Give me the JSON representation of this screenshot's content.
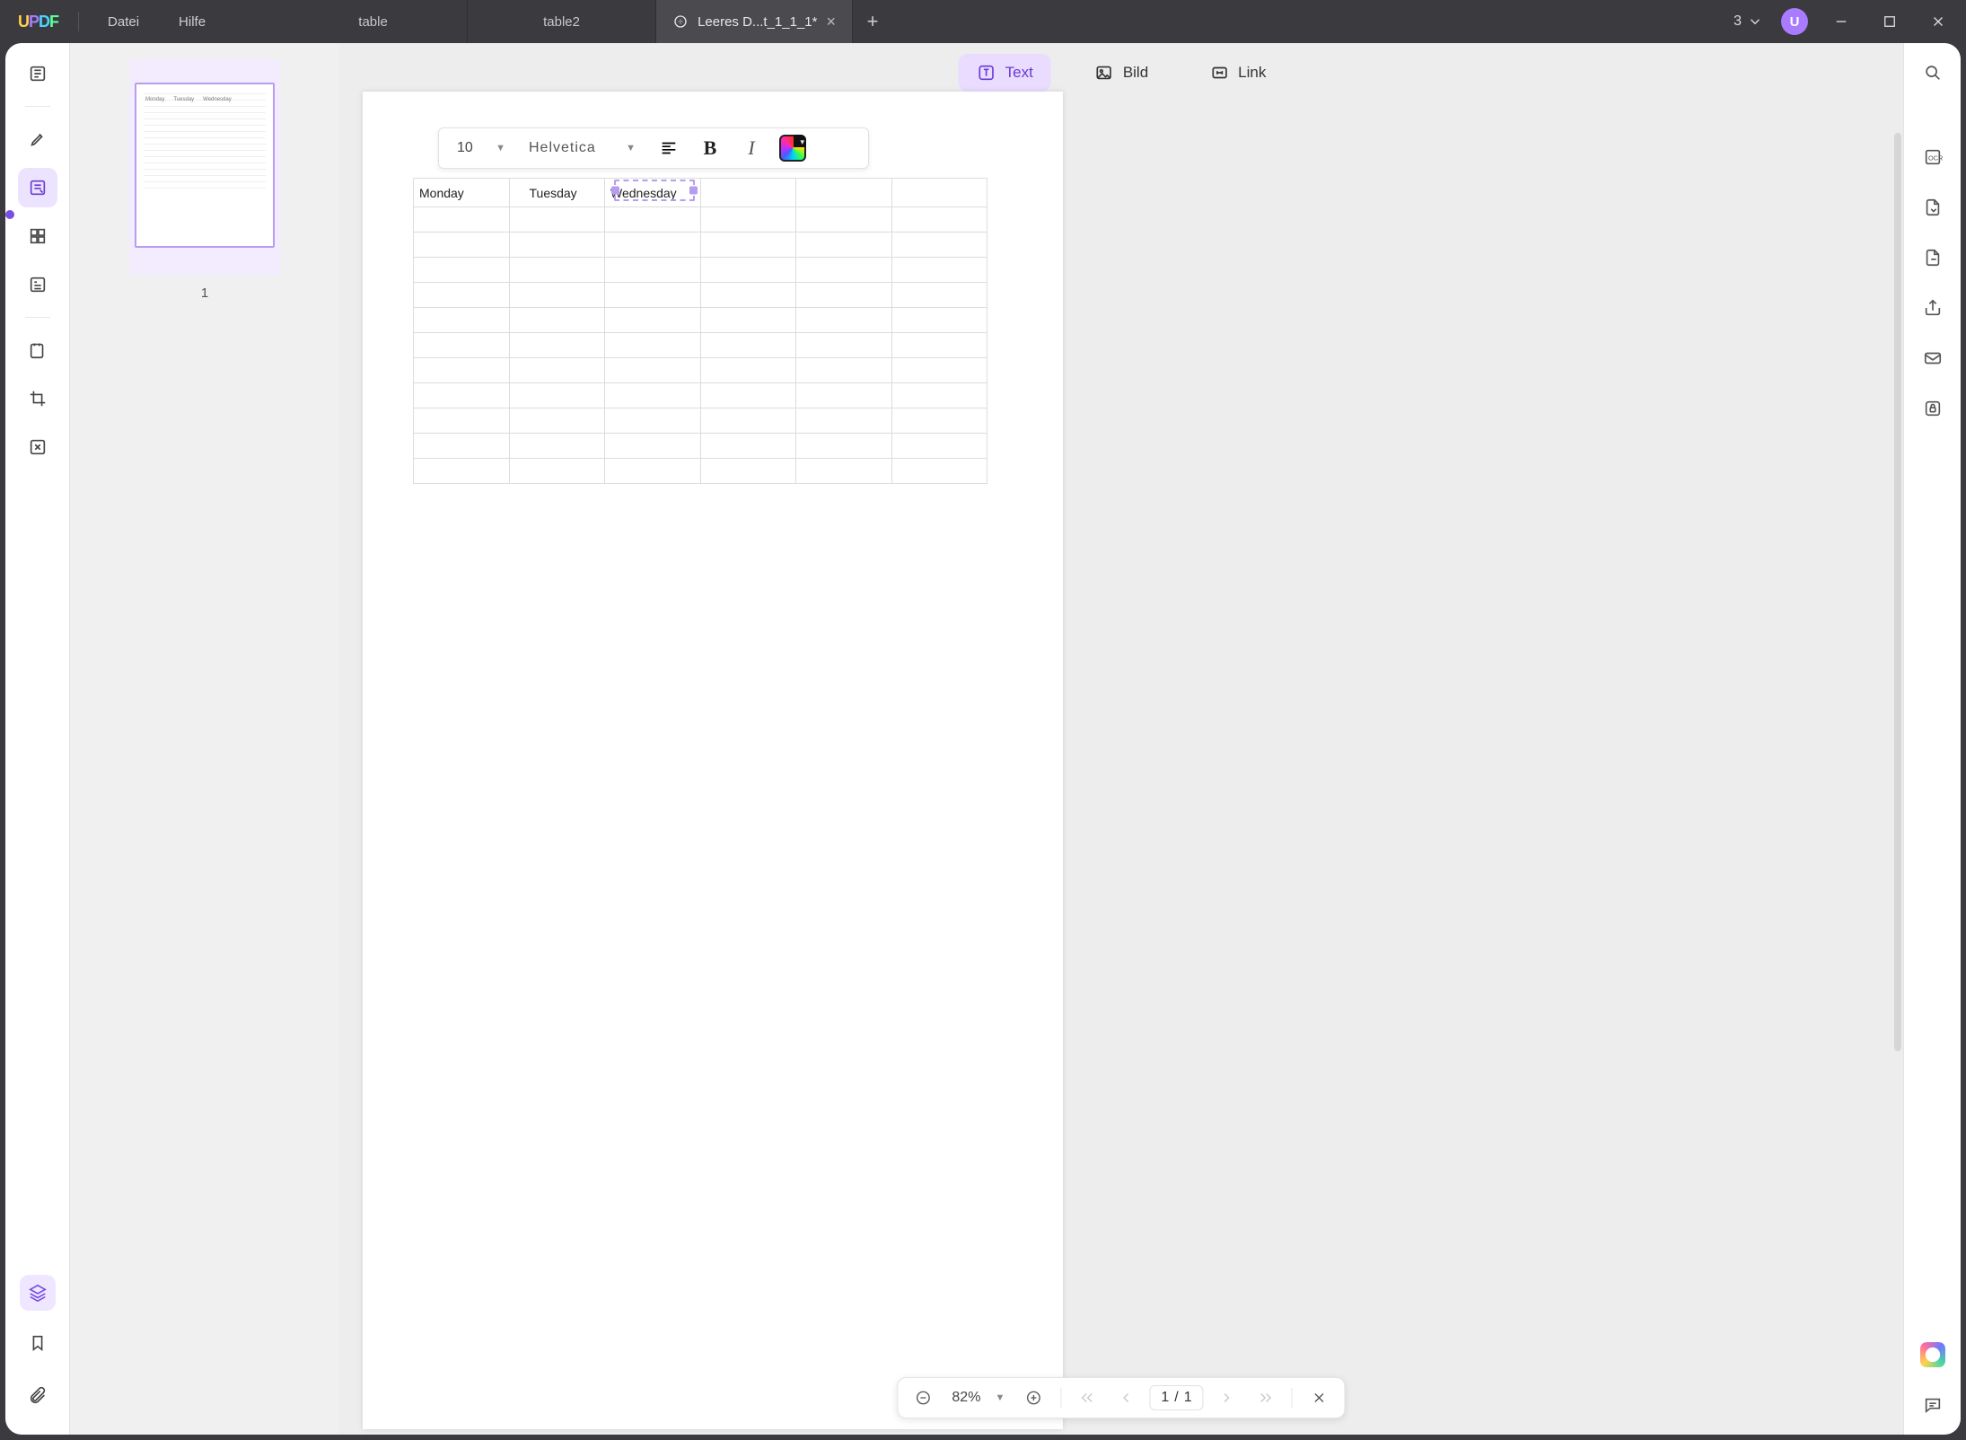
{
  "menus": {
    "file": "Datei",
    "help": "Hilfe"
  },
  "tabs": [
    {
      "label": "table",
      "active": false,
      "closable": false
    },
    {
      "label": "table2",
      "active": false,
      "closable": false
    },
    {
      "label": "Leeres D...t_1_1_1*",
      "active": true,
      "closable": true
    }
  ],
  "title_right": {
    "count": "3",
    "avatar_letter": "U"
  },
  "edit_tools": {
    "text": "Text",
    "image": "Bild",
    "link": "Link"
  },
  "format_toolbar": {
    "font_size": "10",
    "font_name": "Helvetica"
  },
  "thumbnails": {
    "page1": "1",
    "mini_headers": [
      "Monday",
      "Tuesday",
      "Wednesday"
    ]
  },
  "document": {
    "headers": [
      "Monday",
      "Tuesday",
      "Wednesday",
      "",
      "",
      ""
    ],
    "selected_header_index": 2,
    "body_row_count": 11
  },
  "page_controls": {
    "zoom": "82%",
    "page_current": "1",
    "page_sep": "/",
    "page_total": "1"
  }
}
